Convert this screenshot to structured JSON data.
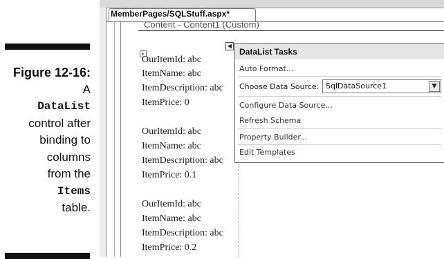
{
  "caption": {
    "figure": "Figure 12-16:",
    "line_a": "A",
    "class_name": "DataList",
    "line_control": "control after",
    "line_binding": "binding to",
    "line_columns": "columns",
    "line_from": "from the",
    "table_name": "Items",
    "line_table": "table."
  },
  "ide": {
    "tab_title": "MemberPages/SQLStuff.aspx*",
    "content_placeholder": "Content - Content1 (Custom)"
  },
  "datalist": {
    "rows": [
      "OurItemId: abc",
      "ItemName: abc",
      "ItemDescription: abc",
      "ItemPrice: 0",
      "OurItemId: abc",
      "ItemName: abc",
      "ItemDescription: abc",
      "ItemPrice: 0.1",
      "OurItemId: abc",
      "ItemName: abc",
      "ItemDescription: abc",
      "ItemPrice: 0.2"
    ]
  },
  "tasks": {
    "title": "DataList Tasks",
    "auto_format": "Auto Format...",
    "choose_label": "Choose Data Source:",
    "data_source_value": "SqlDataSource1",
    "configure": "Configure Data Source...",
    "refresh": "Refresh Schema",
    "property_builder": "Property Builder...",
    "edit_templates": "Edit Templates"
  }
}
